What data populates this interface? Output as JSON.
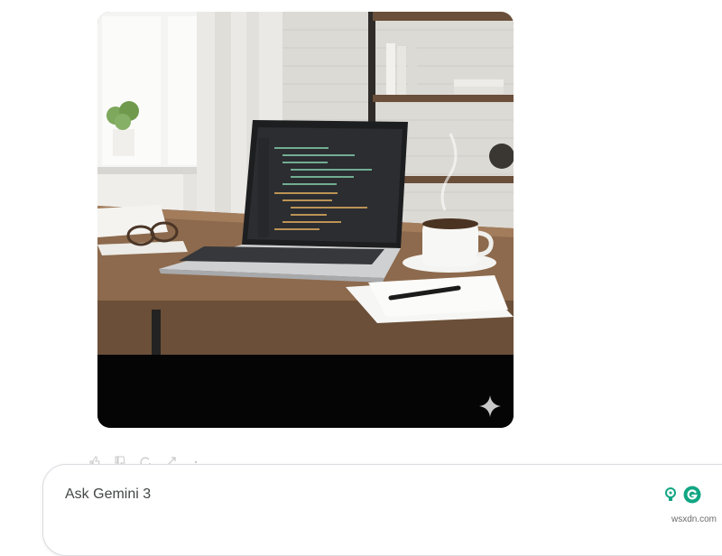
{
  "image": {
    "alt_description": "",
    "badge_icon": "gemini-sparkle-icon"
  },
  "actions": [
    "thumbs-up-icon",
    "thumbs-down-icon",
    "regenerate-icon",
    "share-icon",
    "more-icon"
  ],
  "input": {
    "placeholder": "Ask Gemini 3"
  },
  "extensions": [
    "bulb-extension-icon",
    "grammarly-icon"
  ],
  "watermark": "wsxdn.com",
  "colors": {
    "accent_green": "#11a683",
    "border": "#dadce0"
  }
}
